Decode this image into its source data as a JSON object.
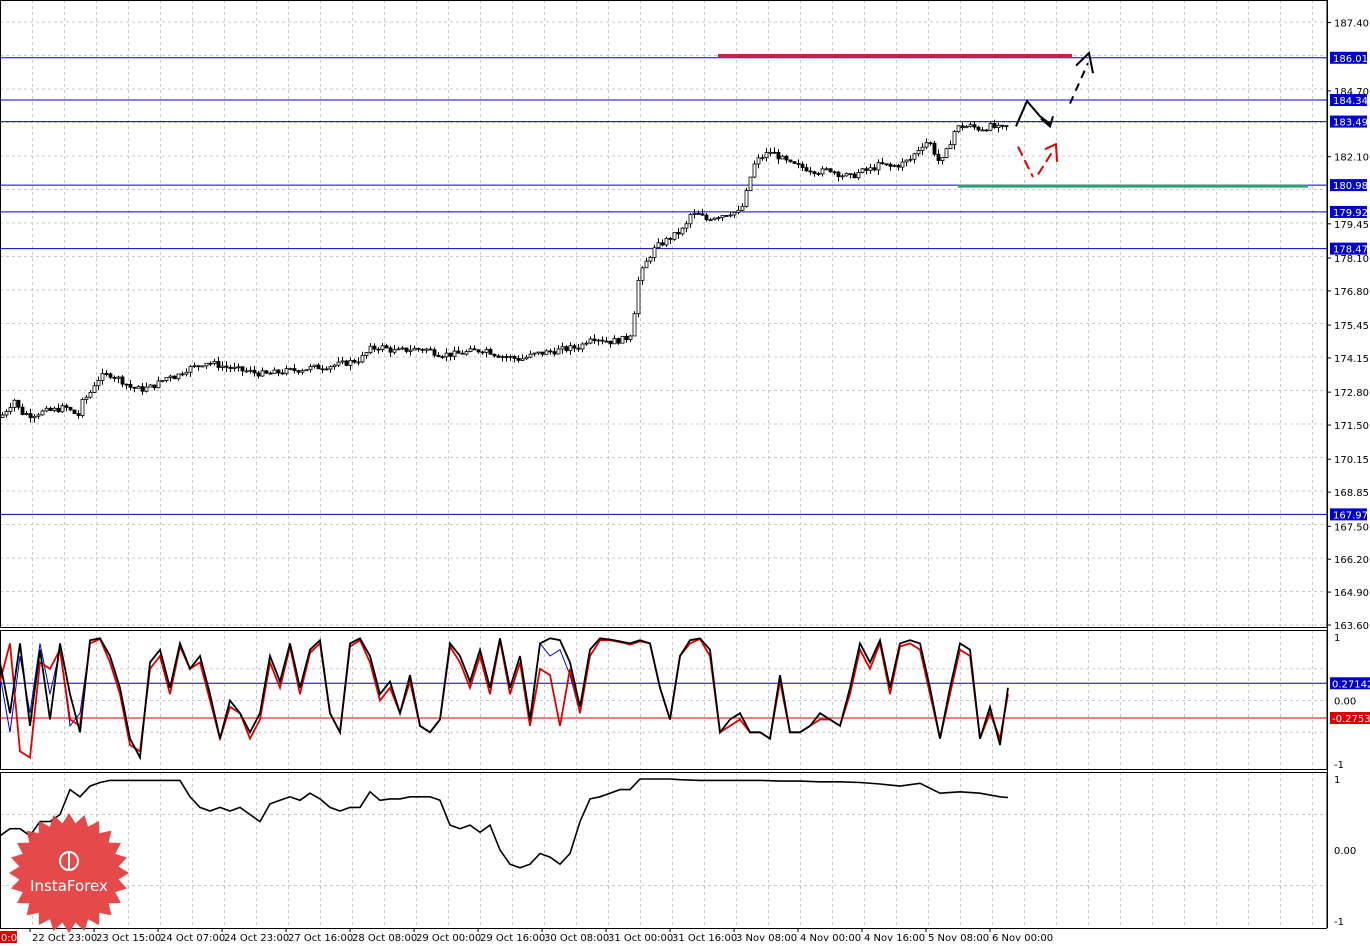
{
  "watermark": {
    "brand": "InstaForex"
  },
  "colors": {
    "grid": "#c8c8c8",
    "level_line": "#0000cc",
    "candle": "#000000",
    "resistance_bar": "#cc2244",
    "support_bar": "#2e9e73",
    "stoch_main": "#000000",
    "stoch_signal": "#dd0000",
    "stoch_extra": "#0000cc",
    "level_upper": "#0000cc",
    "level_lower": "#dd0000",
    "arrow_up": "#000000",
    "arrow_pullback": "#dd0000",
    "tag_bg": "#0000cc",
    "tag_bg_red": "#dd0000"
  },
  "chart_data": [
    {
      "type": "line",
      "panel": "price",
      "ylim": [
        163.6,
        188.2
      ],
      "y_ticks": [
        "187.40",
        "186.01",
        "184.70",
        "184.34",
        "183.49",
        "182.10",
        "180.98",
        "179.92",
        "179.45",
        "178.47",
        "178.10",
        "176.80",
        "175.45",
        "174.15",
        "172.80",
        "171.50",
        "170.15",
        "168.85",
        "167.97",
        "167.50",
        "166.20",
        "164.90",
        "163.60"
      ],
      "x_labels": [
        "22 Oct 23:00",
        "23 Oct 15:00",
        "24 Oct 07:00",
        "24 Oct 23:00",
        "27 Oct 16:00",
        "28 Oct 08:00",
        "29 Oct 00:00",
        "29 Oct 16:00",
        "30 Oct 08:00",
        "31 Oct 00:00",
        "31 Oct 16:00",
        "3 Nov 08:00",
        "4 Nov 00:00",
        "4 Nov 16:00",
        "5 Nov 08:00",
        "6 Nov 00:00"
      ],
      "x_label_left_fragment": "0:00",
      "levels": [
        "186.01",
        "184.34",
        "183.49",
        "180.98",
        "179.92",
        "178.47",
        "167.97"
      ],
      "price_path": {
        "x": [
          0,
          8,
          14,
          20,
          30,
          40,
          55,
          65,
          72,
          78,
          82,
          90,
          95,
          100,
          110,
          120,
          130,
          140,
          150,
          160,
          170,
          175,
          185,
          195,
          205,
          215,
          225,
          235,
          250,
          265,
          280,
          300,
          320,
          340,
          360,
          370,
          380,
          395,
          410,
          425,
          440,
          455,
          470,
          485,
          495,
          505,
          520,
          535,
          550,
          565,
          580,
          590,
          600,
          610,
          625,
          632,
          635,
          638,
          642,
          648,
          655,
          662,
          670,
          678,
          685,
          690,
          700,
          705,
          710,
          720,
          730,
          740,
          745,
          750,
          755,
          762,
          770,
          775,
          782,
          790,
          800,
          810,
          820,
          830,
          840,
          850,
          860,
          870,
          880,
          890,
          900,
          910,
          920,
          925,
          930,
          935,
          940,
          945,
          950,
          955,
          960,
          970,
          980,
          990,
          1000,
          1008
        ],
        "values": [
          171.8,
          172.2,
          172.5,
          172.0,
          171.9,
          172.0,
          172.1,
          172.2,
          172.0,
          171.9,
          172.4,
          172.8,
          173.2,
          173.4,
          173.5,
          173.3,
          173.0,
          172.9,
          173.0,
          173.2,
          173.5,
          173.4,
          173.7,
          173.8,
          174.0,
          173.9,
          173.8,
          173.7,
          173.6,
          173.5,
          173.6,
          173.7,
          173.8,
          173.9,
          174.1,
          174.5,
          174.6,
          174.4,
          174.5,
          174.5,
          174.3,
          174.3,
          174.4,
          174.5,
          174.3,
          174.2,
          174.1,
          174.3,
          174.4,
          174.5,
          174.6,
          175.0,
          174.9,
          174.8,
          174.9,
          175.2,
          176.4,
          177.2,
          177.6,
          178.1,
          178.5,
          178.7,
          178.9,
          179.1,
          179.3,
          179.8,
          179.8,
          179.6,
          179.7,
          179.8,
          179.9,
          179.9,
          180.5,
          181.3,
          181.9,
          182.1,
          182.3,
          182.2,
          182.0,
          181.8,
          181.7,
          181.6,
          181.5,
          181.6,
          181.4,
          181.3,
          181.5,
          181.6,
          181.8,
          181.7,
          181.8,
          182.0,
          182.5,
          182.7,
          182.6,
          182.2,
          181.8,
          182.2,
          182.7,
          183.2,
          183.3,
          183.3,
          183.2,
          183.3,
          183.2,
          183.3
        ]
      },
      "resistance_bar": {
        "price": 186.1,
        "x_start_label": "4 Nov 00:00",
        "x_end_label": "beyond 6 Nov 00:00"
      },
      "support_bar": {
        "price": 180.98
      },
      "forecast": {
        "bullish": "rise to 183.9, pullback near 183.49, then up to 186.01",
        "pullback": "dip toward 181.2 then return to 182.0"
      }
    },
    {
      "type": "line",
      "panel": "stochastic",
      "ylim": [
        -1,
        1
      ],
      "y_ticks": [
        "1",
        "0.27142",
        "0.00",
        "-0.27538",
        "-1"
      ],
      "levels": {
        "upper": 0.27142,
        "lower": -0.27538
      },
      "series": [
        {
          "color": "#000000",
          "x": [
            0,
            10,
            20,
            30,
            40,
            50,
            60,
            70,
            80,
            90,
            100,
            110,
            120,
            130,
            140,
            150,
            160,
            170,
            180,
            190,
            200,
            210,
            220,
            230,
            240,
            250,
            260,
            270,
            280,
            290,
            300,
            310,
            320,
            330,
            340,
            350,
            360,
            370,
            380,
            390,
            400,
            410,
            420,
            430,
            440,
            450,
            460,
            470,
            480,
            490,
            500,
            510,
            520,
            530,
            540,
            550,
            560,
            570,
            580,
            590,
            600,
            610,
            620,
            630,
            640,
            650,
            660,
            670,
            680,
            690,
            700,
            710,
            720,
            730,
            740,
            750,
            760,
            770,
            780,
            790,
            800,
            810,
            820,
            830,
            840,
            850,
            860,
            870,
            880,
            890,
            900,
            910,
            920,
            930,
            940,
            950,
            960,
            970,
            980,
            990,
            1000,
            1008
          ],
          "values": [
            0.6,
            -0.2,
            0.9,
            -0.4,
            0.8,
            -0.3,
            0.9,
            0.1,
            -0.5,
            0.95,
            0.98,
            0.7,
            0.2,
            -0.6,
            -0.9,
            0.6,
            0.8,
            0.2,
            0.9,
            0.5,
            0.7,
            0.1,
            -0.6,
            0.0,
            -0.2,
            -0.5,
            -0.2,
            0.7,
            0.3,
            0.9,
            0.2,
            0.8,
            0.95,
            -0.2,
            -0.5,
            0.9,
            0.98,
            0.7,
            0.1,
            0.3,
            -0.2,
            0.4,
            -0.4,
            -0.5,
            -0.3,
            0.9,
            0.7,
            0.3,
            0.8,
            0.2,
            0.98,
            0.2,
            0.7,
            -0.3,
            0.9,
            0.98,
            0.95,
            0.6,
            -0.1,
            0.8,
            0.98,
            0.96,
            0.93,
            0.9,
            0.95,
            0.9,
            0.2,
            -0.3,
            0.7,
            0.95,
            0.98,
            0.8,
            -0.5,
            -0.3,
            -0.2,
            -0.5,
            -0.5,
            -0.6,
            0.4,
            -0.5,
            -0.5,
            -0.4,
            -0.2,
            -0.3,
            -0.4,
            0.2,
            0.9,
            0.6,
            0.95,
            0.2,
            0.9,
            0.95,
            0.9,
            0.2,
            -0.6,
            0.2,
            0.9,
            0.8,
            -0.6,
            -0.1,
            -0.7,
            0.2
          ]
        },
        {
          "color": "#dd0000",
          "x": [
            0,
            10,
            20,
            30,
            40,
            50,
            60,
            70,
            80,
            90,
            100,
            110,
            120,
            130,
            140,
            150,
            160,
            170,
            180,
            190,
            200,
            210,
            220,
            230,
            240,
            250,
            260,
            270,
            280,
            290,
            300,
            310,
            320,
            330,
            340,
            350,
            360,
            370,
            380,
            390,
            400,
            410,
            420,
            430,
            440,
            450,
            460,
            470,
            480,
            490,
            500,
            510,
            520,
            530,
            540,
            550,
            560,
            570,
            580,
            590,
            600,
            610,
            620,
            630,
            640,
            650,
            660,
            670,
            680,
            690,
            700,
            710,
            720,
            730,
            740,
            750,
            760,
            770,
            780,
            790,
            800,
            810,
            820,
            830,
            840,
            850,
            860,
            870,
            880,
            890,
            900,
            910,
            920,
            930,
            940,
            950,
            960,
            970,
            980,
            990,
            1000,
            1008
          ],
          "values": [
            0.3,
            0.9,
            -0.8,
            -0.9,
            0.6,
            0.5,
            0.8,
            -0.3,
            -0.4,
            0.9,
            0.97,
            0.6,
            0.1,
            -0.7,
            -0.8,
            0.5,
            0.7,
            0.1,
            0.85,
            0.5,
            0.6,
            0.0,
            -0.6,
            -0.1,
            -0.2,
            -0.6,
            -0.3,
            0.6,
            0.2,
            0.85,
            0.1,
            0.75,
            0.9,
            -0.2,
            -0.5,
            0.85,
            0.95,
            0.6,
            0.0,
            0.2,
            -0.2,
            0.3,
            -0.4,
            -0.5,
            -0.3,
            0.85,
            0.6,
            0.2,
            0.7,
            0.1,
            0.95,
            0.1,
            0.6,
            -0.4,
            0.5,
            0.4,
            -0.4,
            0.5,
            -0.2,
            0.7,
            0.95,
            0.95,
            0.92,
            0.88,
            0.93,
            0.9,
            0.2,
            -0.3,
            0.7,
            0.9,
            0.97,
            0.7,
            -0.5,
            -0.4,
            -0.3,
            -0.5,
            -0.5,
            -0.6,
            0.3,
            -0.5,
            -0.5,
            -0.4,
            -0.3,
            -0.3,
            -0.4,
            0.1,
            0.8,
            0.5,
            0.9,
            0.1,
            0.85,
            0.9,
            0.8,
            0.1,
            -0.6,
            0.1,
            0.8,
            0.7,
            -0.6,
            -0.2,
            -0.6,
            0.1
          ]
        },
        {
          "color": "#0000cc",
          "x": [
            0,
            10,
            20,
            30,
            40,
            50,
            60,
            70,
            80,
            90,
            100,
            110,
            120,
            130,
            140,
            150,
            160,
            170,
            180,
            190,
            200,
            210,
            220,
            230,
            240,
            250,
            260,
            270,
            280,
            290,
            300,
            310,
            320,
            330,
            340,
            350,
            360,
            370,
            380,
            390,
            400,
            410,
            420,
            430,
            440,
            450,
            460,
            470,
            480,
            490,
            500,
            510,
            520,
            530,
            540,
            550,
            560,
            570,
            580,
            590,
            600,
            610,
            620,
            630,
            640,
            650,
            660,
            670,
            680,
            690,
            700,
            710,
            720,
            730,
            740,
            750,
            760,
            770,
            780,
            790,
            800,
            810,
            820,
            830,
            840,
            850,
            860,
            870,
            880,
            890,
            900,
            910,
            920,
            930,
            940,
            950,
            960,
            970,
            980,
            990,
            1000,
            1008
          ],
          "values": [
            0.4,
            -0.5,
            0.7,
            -0.2,
            0.9,
            0.1,
            0.8,
            -0.4,
            -0.2,
            0.9,
            0.97,
            0.6,
            0.1,
            -0.7,
            -0.8,
            0.5,
            0.7,
            0.1,
            0.85,
            0.5,
            0.6,
            0.0,
            -0.6,
            -0.1,
            -0.2,
            -0.6,
            -0.3,
            0.6,
            0.2,
            0.85,
            0.1,
            0.75,
            0.9,
            -0.2,
            -0.5,
            0.85,
            0.95,
            0.6,
            0.0,
            0.2,
            -0.2,
            0.3,
            -0.4,
            -0.5,
            -0.3,
            0.85,
            0.6,
            0.2,
            0.7,
            0.1,
            0.95,
            0.1,
            0.6,
            -0.4,
            0.9,
            0.7,
            0.8,
            0.4,
            -0.2,
            0.7,
            0.95,
            0.95,
            0.92,
            0.88,
            0.93,
            0.9,
            0.2,
            -0.3,
            0.7,
            0.9,
            0.97,
            0.7,
            -0.5,
            -0.4,
            -0.3,
            -0.5,
            -0.5,
            -0.6,
            0.3,
            -0.5,
            -0.5,
            -0.4,
            -0.3,
            -0.3,
            -0.4,
            0.1,
            0.8,
            0.5,
            0.9,
            0.1,
            0.85,
            0.9,
            0.8,
            0.1,
            -0.6,
            0.1,
            0.8,
            0.7,
            -0.6,
            -0.2,
            -0.6,
            0.1
          ]
        }
      ]
    },
    {
      "type": "line",
      "panel": "oscillator",
      "ylim": [
        -1,
        1
      ],
      "y_ticks": [
        "1",
        "0.00",
        "-1"
      ],
      "series": [
        {
          "color": "#000000",
          "x": [
            0,
            10,
            20,
            30,
            40,
            50,
            60,
            70,
            80,
            90,
            100,
            110,
            120,
            130,
            140,
            150,
            160,
            170,
            180,
            190,
            200,
            210,
            220,
            230,
            240,
            250,
            260,
            270,
            280,
            290,
            300,
            310,
            320,
            330,
            340,
            350,
            360,
            370,
            380,
            390,
            400,
            410,
            420,
            430,
            440,
            450,
            460,
            470,
            480,
            490,
            500,
            510,
            520,
            530,
            540,
            550,
            560,
            570,
            580,
            590,
            600,
            610,
            620,
            630,
            640,
            650,
            660,
            670,
            680,
            700,
            720,
            740,
            760,
            780,
            800,
            820,
            840,
            860,
            880,
            900,
            920,
            940,
            960,
            980,
            1000,
            1008
          ],
          "values": [
            0.2,
            0.3,
            0.3,
            0.2,
            0.4,
            0.4,
            0.5,
            0.85,
            0.75,
            0.9,
            0.95,
            0.98,
            0.98,
            0.98,
            0.98,
            0.98,
            0.98,
            0.98,
            0.98,
            0.75,
            0.6,
            0.55,
            0.6,
            0.55,
            0.6,
            0.5,
            0.4,
            0.65,
            0.7,
            0.75,
            0.7,
            0.8,
            0.72,
            0.6,
            0.55,
            0.6,
            0.6,
            0.82,
            0.7,
            0.72,
            0.72,
            0.75,
            0.75,
            0.75,
            0.7,
            0.35,
            0.3,
            0.35,
            0.25,
            0.35,
            0.0,
            -0.2,
            -0.25,
            -0.2,
            -0.05,
            -0.1,
            -0.2,
            -0.05,
            0.4,
            0.72,
            0.75,
            0.8,
            0.85,
            0.85,
            1.0,
            1.0,
            1.0,
            1.0,
            0.99,
            0.98,
            0.98,
            0.98,
            0.98,
            0.97,
            0.97,
            0.96,
            0.96,
            0.95,
            0.93,
            0.9,
            0.94,
            0.8,
            0.82,
            0.8,
            0.75,
            0.74
          ]
        }
      ]
    }
  ]
}
